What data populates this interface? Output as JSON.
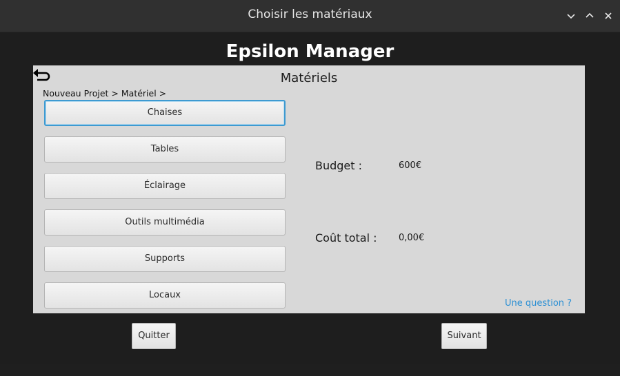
{
  "window": {
    "title": "Choisir les matériaux",
    "controls": [
      "chevron-down-icon",
      "chevron-up-icon",
      "close-icon"
    ]
  },
  "app": {
    "title": "Epsilon Manager"
  },
  "panel": {
    "title": "Matériels",
    "breadcrumb": "Nouveau Projet > Matériel >",
    "back_icon": "undo-arrow-icon",
    "buttons": [
      {
        "label": "Chaises"
      },
      {
        "label": "Tables"
      },
      {
        "label": "Éclairage"
      },
      {
        "label": "Outils multimédia"
      },
      {
        "label": "Supports"
      },
      {
        "label": "Locaux"
      }
    ],
    "budget": {
      "label": "Budget :",
      "value": "600€"
    },
    "total": {
      "label": "Coût total :",
      "value": "0,00€"
    },
    "help_link": "Une question ?"
  },
  "footer": {
    "quit_label": "Quitter",
    "next_label": "Suivant"
  },
  "colors": {
    "panel_bg": "#d8d8d8",
    "window_bg": "#1e1e1e",
    "focus": "#3d9ad1",
    "link": "#2a8fd4"
  }
}
